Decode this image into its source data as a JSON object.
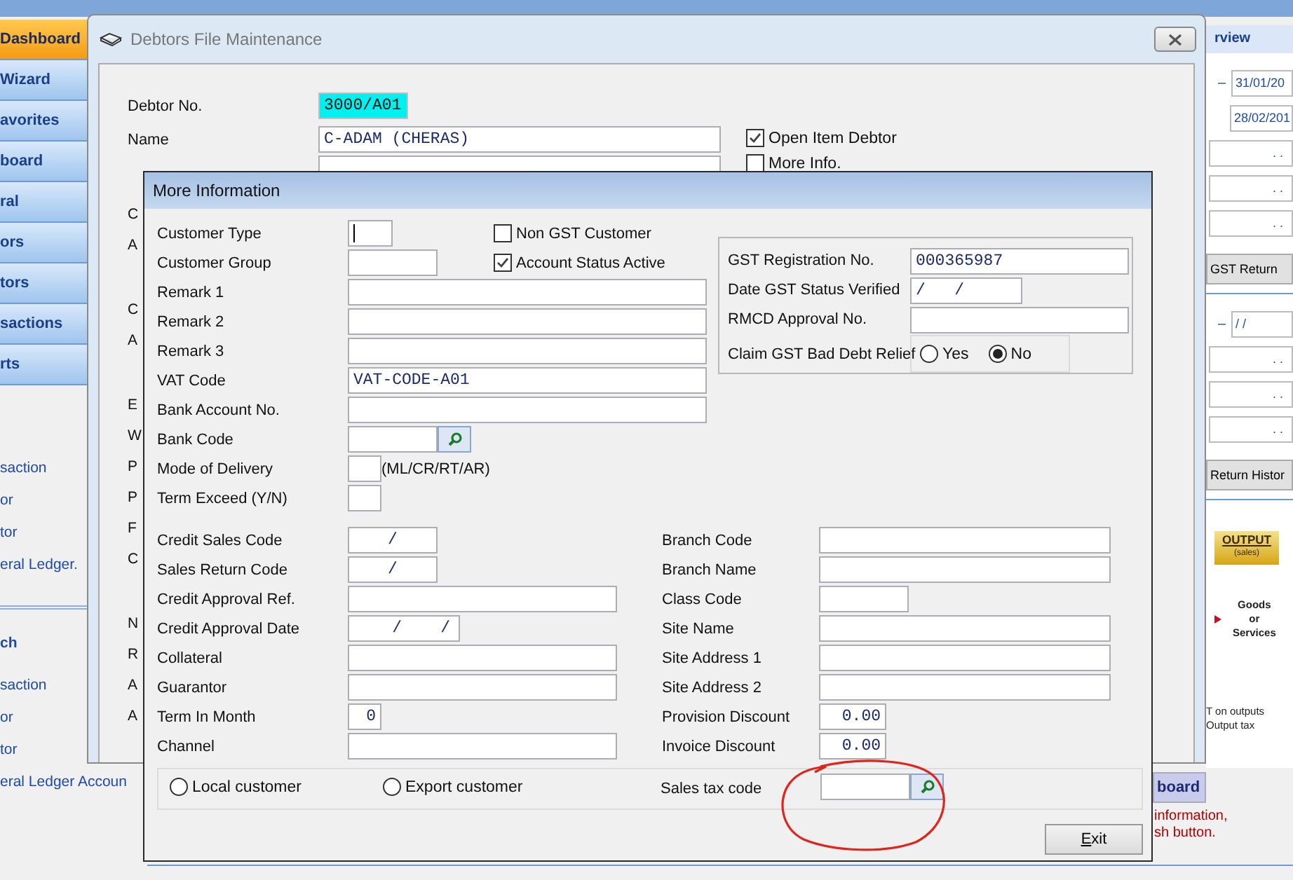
{
  "background_app": {
    "nav_items": [
      {
        "label": "Dashboard",
        "selected": true
      },
      {
        "label": "Wizard",
        "selected": false
      },
      {
        "label": "avorites",
        "selected": false
      },
      {
        "label": "board",
        "selected": false
      },
      {
        "label": "ral",
        "selected": false
      },
      {
        "label": "ors",
        "selected": false
      },
      {
        "label": "tors",
        "selected": false
      },
      {
        "label": "sactions",
        "selected": false
      },
      {
        "label": "rts",
        "selected": false
      }
    ],
    "link_groups": [
      {
        "links": [
          "saction",
          "or",
          "tor",
          "eral Ledger."
        ]
      },
      {
        "header": "ch",
        "links": [
          "saction",
          "or",
          "tor",
          "eral Ledger Accoun"
        ]
      }
    ]
  },
  "side_panel": {
    "tab": "rview",
    "sections": [
      {
        "rows": [
          {
            "kind": "date",
            "prefix": "–",
            "value": "31/01/20"
          },
          {
            "kind": "date",
            "value": "28/02/201"
          },
          {
            "kind": "field",
            "value": ". ."
          },
          {
            "kind": "field",
            "value": ". ."
          },
          {
            "kind": "field",
            "value": ". ."
          },
          {
            "kind": "button",
            "label": "GST Return"
          }
        ]
      },
      {
        "rows": [
          {
            "kind": "date",
            "prefix": "–",
            "value": "/ /"
          },
          {
            "kind": "field",
            "value": ". ."
          },
          {
            "kind": "field",
            "value": ". ."
          },
          {
            "kind": "field",
            "value": ". ."
          },
          {
            "kind": "button",
            "label": "Return Histor"
          }
        ]
      }
    ],
    "badge": {
      "title": "OUTPUT",
      "subtitle": "(sales)"
    },
    "diagram_label": "Goods or Services",
    "note_lines": [
      "T on outputs",
      "Output tax"
    ]
  },
  "footer_area": {
    "button": "board",
    "hint_lines": [
      "information,",
      "sh button."
    ]
  },
  "debtors_window": {
    "title": "Debtors File Maintenance",
    "fields": [
      {
        "label": "Debtor No.",
        "kind": "highlighted",
        "value": "3000/A01"
      },
      {
        "label": "Name",
        "kind": "plain",
        "value": "C-ADAM (CHERAS)"
      }
    ],
    "options": [
      {
        "label": "Open Item Debtor",
        "checked": true
      },
      {
        "label": "More Info.",
        "checked": false
      }
    ],
    "fragment_groups": [
      [
        "C",
        "A"
      ],
      [
        "C",
        "A"
      ],
      [
        "E",
        "W",
        "P",
        "P",
        "F",
        "C"
      ],
      [
        "N",
        "R",
        "A",
        "A"
      ]
    ]
  },
  "more_information": {
    "title": "More Information",
    "upper_fields": [
      {
        "label": "Customer Type",
        "kind": "short",
        "focused": true
      },
      {
        "label": "Customer Group",
        "kind": "code",
        "focused": false
      },
      {
        "label": "Remark 1",
        "kind": "full",
        "focused": false
      },
      {
        "label": "Remark 2",
        "kind": "full",
        "focused": false
      },
      {
        "label": "Remark 3",
        "kind": "full",
        "focused": false
      },
      {
        "label": "VAT Code",
        "kind": "full",
        "value": "VAT-CODE-A01",
        "focused": false
      },
      {
        "label": "Bank Account No.",
        "kind": "full",
        "focused": false
      },
      {
        "label": "Bank Code",
        "kind": "lookup",
        "focused": false
      },
      {
        "label": "Mode of Delivery",
        "kind": "tiny",
        "hint": "(ML/CR/RT/AR)",
        "focused": false
      },
      {
        "label": "Term Exceed (Y/N)",
        "kind": "tiny",
        "focused": false
      }
    ],
    "flags": [
      {
        "label": "Non GST Customer",
        "checked": false
      },
      {
        "label": "Account Status Active",
        "checked": true
      }
    ],
    "gst": {
      "fields": [
        {
          "label": "GST Registration No.",
          "kind": "full",
          "value": "000365987"
        },
        {
          "label": "Date GST Status Verified",
          "kind": "date",
          "value": "/   /"
        },
        {
          "label": "RMCD Approval No.",
          "kind": "full"
        }
      ],
      "bad_debt_relief": {
        "label": "Claim GST Bad Debt Relief",
        "options": [
          {
            "label": "Yes",
            "selected": false
          },
          {
            "label": "No",
            "selected": true
          }
        ]
      }
    },
    "lower_left": [
      {
        "label": "Credit Sales Code",
        "kind": "code",
        "value": "/"
      },
      {
        "label": "Sales Return Code",
        "kind": "code",
        "value": "/"
      },
      {
        "label": "Credit Approval Ref.",
        "kind": "full"
      },
      {
        "label": "Credit Approval Date",
        "kind": "date",
        "value": "    /    /"
      },
      {
        "label": "Collateral",
        "kind": "full"
      },
      {
        "label": "Guarantor",
        "kind": "full"
      },
      {
        "label": "Term In Month",
        "kind": "number",
        "value": "0"
      },
      {
        "label": "Channel",
        "kind": "full"
      }
    ],
    "lower_right": [
      {
        "label": "Branch Code",
        "kind": "full"
      },
      {
        "label": "Branch Name",
        "kind": "full"
      },
      {
        "label": "Class Code",
        "kind": "code"
      },
      {
        "label": "Site Name",
        "kind": "full"
      },
      {
        "label": "Site Address 1",
        "kind": "full"
      },
      {
        "label": "Site Address 2",
        "kind": "full"
      },
      {
        "label": "Provision Discount",
        "kind": "amount",
        "value": "0.00"
      },
      {
        "label": "Invoice Discount",
        "kind": "amount",
        "value": "0.00"
      }
    ],
    "customer_origin": [
      {
        "label": "Local customer",
        "selected": false
      },
      {
        "label": "Export customer",
        "selected": false
      }
    ],
    "sales_tax_code": {
      "label": "Sales tax code",
      "kind": "lookup"
    },
    "exit_button": "Exit"
  }
}
